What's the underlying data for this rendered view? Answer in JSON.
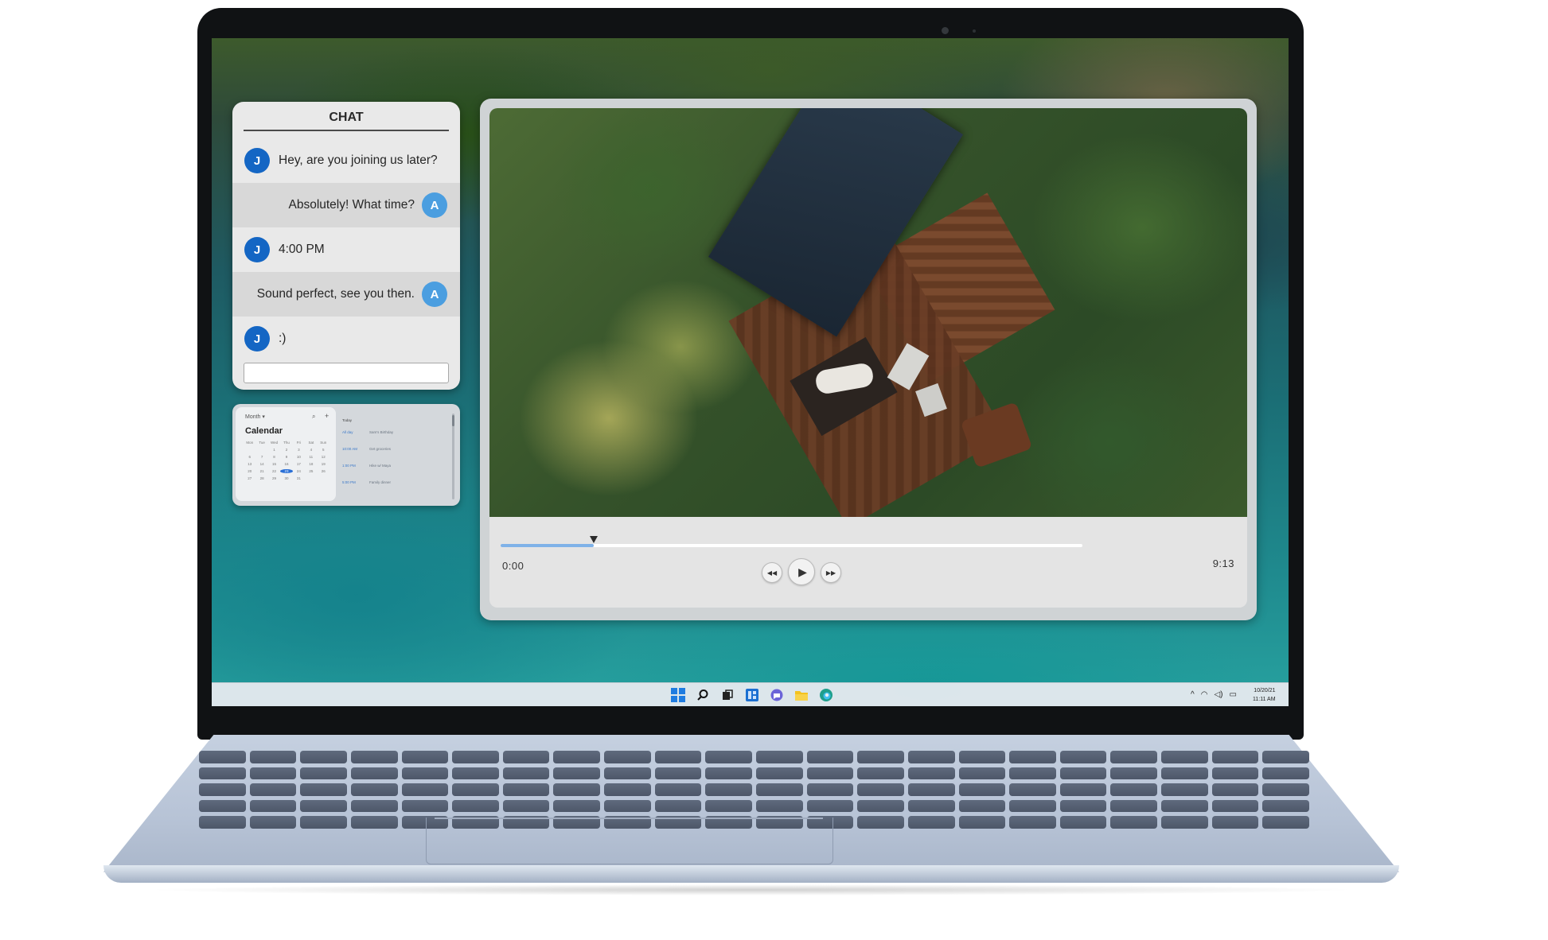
{
  "chat": {
    "title": "CHAT",
    "messages": [
      {
        "avatar": "J",
        "text": "Hey, are you joining us later?"
      },
      {
        "avatar": "A",
        "text": "Absolutely! What time?"
      },
      {
        "avatar": "J",
        "text": "4:00 PM"
      },
      {
        "avatar": "A",
        "text": "Sound perfect, see you then."
      },
      {
        "avatar": "J",
        "text": ":)"
      }
    ],
    "input_value": ""
  },
  "calendar": {
    "view_label": "Month ▾",
    "title": "Calendar",
    "weekday_headers": [
      "Mon",
      "Tue",
      "Wed",
      "Thu",
      "Fri",
      "Sat",
      "Sun"
    ],
    "days": [
      "",
      "",
      "1",
      "2",
      "3",
      "4",
      "5",
      "6",
      "7",
      "8",
      "9",
      "10",
      "11",
      "12",
      "13",
      "14",
      "15",
      "16",
      "17",
      "18",
      "19",
      "20",
      "21",
      "22",
      "23",
      "24",
      "25",
      "26",
      "27",
      "28",
      "29",
      "30",
      "31",
      "",
      ""
    ],
    "selected_day": "23",
    "agenda_header": "Today",
    "agenda": [
      {
        "time": "All day",
        "title": "Sam's Birthday"
      },
      {
        "time": "10:00 AM",
        "title": "Get groceries"
      },
      {
        "time": "1:00 PM",
        "title": "Hike w/ Maya"
      },
      {
        "time": "5:00 PM",
        "title": "Family dinner"
      }
    ]
  },
  "player": {
    "time_current": "0:00",
    "time_total": "9:13",
    "progress": 0.16,
    "controls": {
      "prev_icon": "rewind-icon",
      "play_icon": "play-icon",
      "next_icon": "fast-forward-icon"
    }
  },
  "taskbar": {
    "icons": [
      "windows-start-icon",
      "search-icon",
      "task-view-icon",
      "widgets-icon",
      "chat-icon",
      "file-explorer-icon",
      "edge-browser-icon"
    ],
    "date": "10/20/21",
    "time": "11:11 AM"
  },
  "colors": {
    "avatar_j": "#1466c4",
    "avatar_a": "#4b9ee0",
    "progress_fill": "#7fb2e8",
    "laptop_body": "#b7c3d6"
  }
}
